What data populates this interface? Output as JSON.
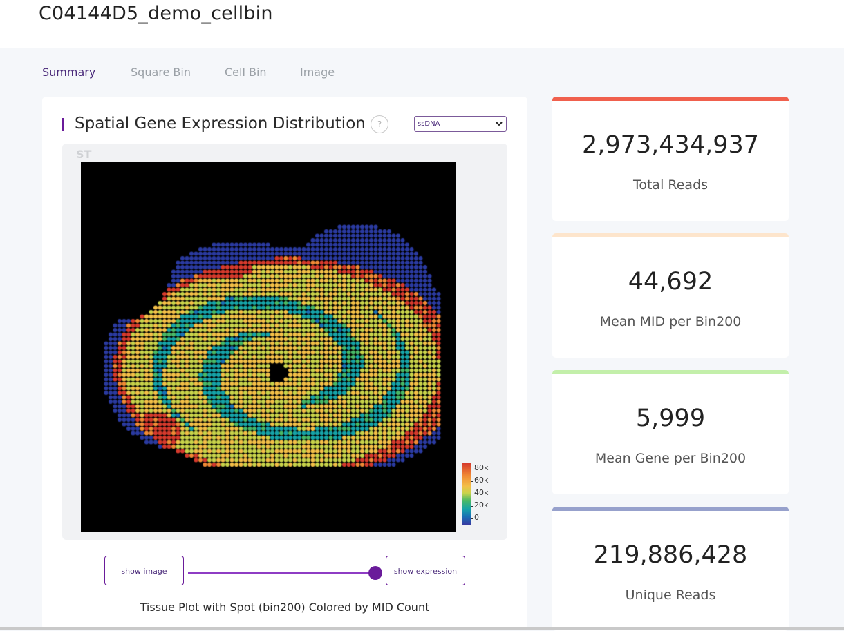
{
  "page": {
    "title": "C04144D5_demo_cellbin"
  },
  "tabs": [
    {
      "label": "Summary",
      "active": true
    },
    {
      "label": "Square Bin",
      "active": false
    },
    {
      "label": "Cell Bin",
      "active": false
    },
    {
      "label": "Image",
      "active": false
    }
  ],
  "section": {
    "title": "Spatial Gene Expression Distribution",
    "help": "?",
    "select_value": "ssDNA",
    "plot_label": "ST",
    "caption": "Tissue Plot with Spot (bin200) Colored by MID Count"
  },
  "colorbar": {
    "ticks": [
      "80k",
      "60k",
      "40k",
      "20k",
      "0"
    ],
    "colors": [
      "#3b36a0",
      "#1a6fb5",
      "#16a3a8",
      "#48b866",
      "#c8d34a",
      "#f3bf47",
      "#f08a35",
      "#d63a2c"
    ]
  },
  "toggle": {
    "left_label": "show image",
    "right_label": "show expression",
    "value": 1
  },
  "stats": [
    {
      "value": "2,973,434,937",
      "label": "Total Reads",
      "accent": "#f0604d"
    },
    {
      "value": "44,692",
      "label": "Mean MID per Bin200",
      "accent": "#fde5cc"
    },
    {
      "value": "5,999",
      "label": "Mean Gene per Bin200",
      "accent": "#c3efaa"
    },
    {
      "value": "219,886,428",
      "label": "Unique Reads",
      "accent": "#97a1cc"
    }
  ]
}
